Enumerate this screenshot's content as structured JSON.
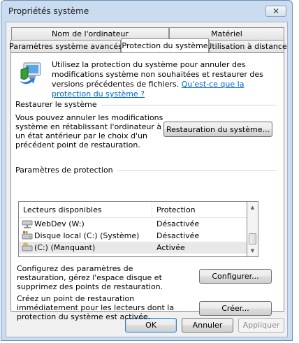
{
  "window": {
    "title": "Propriétés système",
    "close_glyph": "✕"
  },
  "tabs": {
    "row_back": [
      "Nom de l'ordinateur",
      "Matériel"
    ],
    "row_front": [
      "Paramètres système avancés",
      "Protection du système",
      "Utilisation à distance"
    ],
    "active": "Protection du système"
  },
  "intro": {
    "text": "Utilisez la protection du système pour annuler des modifications système non souhaitées et restaurer des versions précédentes de fichiers.",
    "link": "Qu'est-ce que la protection du système ?",
    "icon": "system-protection-shield-icon"
  },
  "restore": {
    "group_title": "Restaurer le système",
    "description": "Vous pouvez annuler les modifications système en rétablissant l'ordinateur à un état antérieur par le choix d'un précédent point de restauration.",
    "button": "Restauration du système..."
  },
  "protection": {
    "group_title": "Paramètres de protection",
    "columns": [
      "Lecteurs disponibles",
      "Protection"
    ],
    "drives": [
      {
        "name": "WebDev (W:)",
        "status": "Désactivée",
        "icon": "network-drive-icon"
      },
      {
        "name": "Disque local (C:) (Système)",
        "status": "Désactivée",
        "icon": "system-disk-icon"
      },
      {
        "name": "(C:) (Manquant)",
        "status": "Activée",
        "icon": "disk-icon"
      }
    ],
    "configure_text": "Configurez des paramètres de restauration, gérez l'espace disque et supprimez des points de restauration.",
    "configure_button": "Configurer...",
    "create_text": "Créez un point de restauration immédiatement pour les lecteurs dont la protection du système est activée.",
    "create_button": "Créer..."
  },
  "footer": {
    "ok": "OK",
    "cancel": "Annuler",
    "apply": "Appliquer"
  }
}
